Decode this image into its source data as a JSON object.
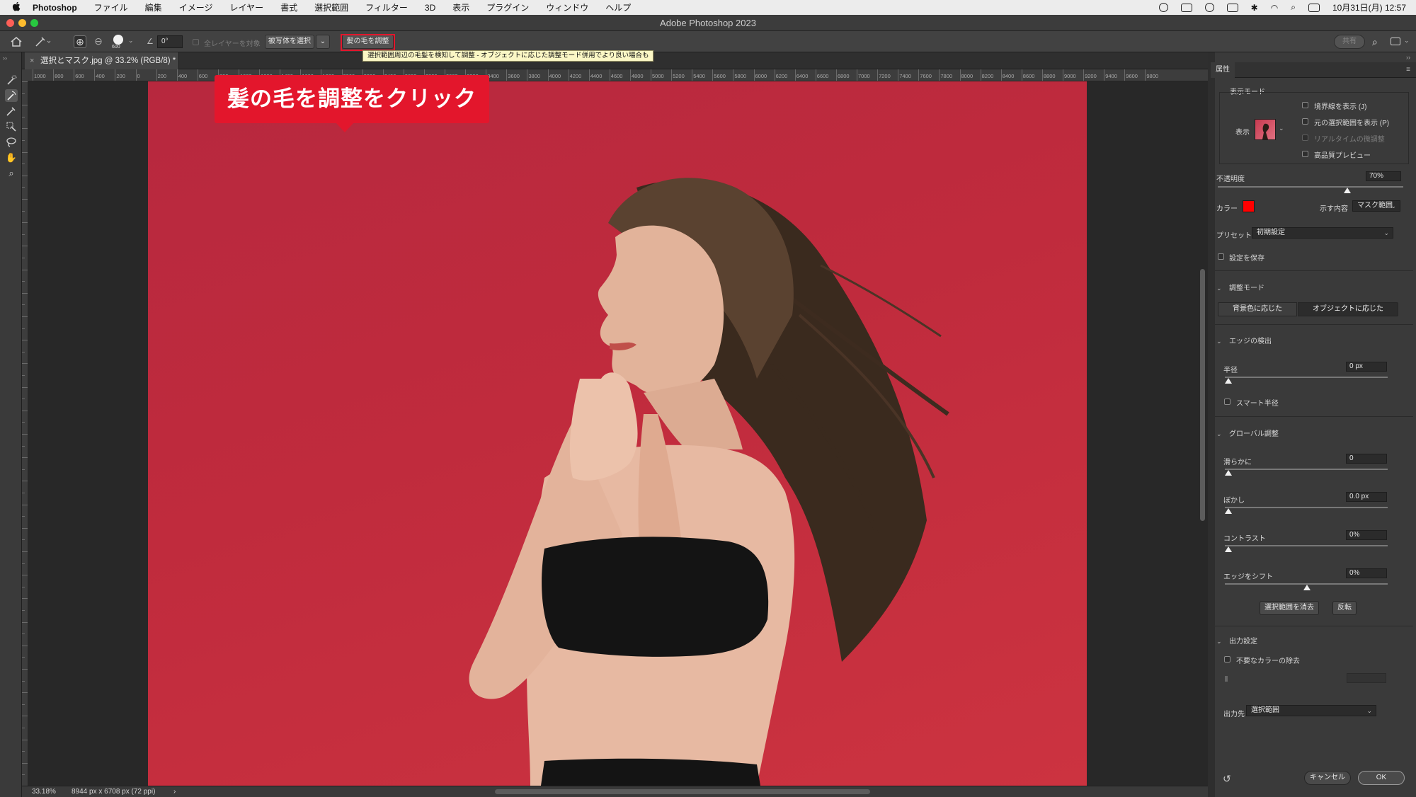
{
  "menubar": {
    "apple": "",
    "app_name": "Photoshop",
    "items": [
      "ファイル",
      "編集",
      "イメージ",
      "レイヤー",
      "書式",
      "選択範囲",
      "フィルター",
      "3D",
      "表示",
      "プラグイン",
      "ウィンドウ",
      "ヘルプ"
    ],
    "clock": "10月31日(月)  12:57"
  },
  "window": {
    "title": "Adobe Photoshop 2023"
  },
  "options_bar": {
    "brush_size": "600",
    "angle": "0°",
    "sample_all_layers": "全レイヤーを対象",
    "select_subject": "被写体を選択",
    "refine_hair": "髪の毛を調整",
    "share": "共有"
  },
  "tooltip": {
    "text": "選択範囲周辺の毛髪を検知して調整 - オブジェクトに応じた調整モード併用でより良い場合も"
  },
  "document": {
    "tab_title": "選択とマスク.jpg @ 33.2% (RGB/8) *",
    "close": "×"
  },
  "rulers": {
    "h_ticks": [
      "1000",
      "800",
      "600",
      "400",
      "200",
      "0",
      "200",
      "400",
      "600",
      "800",
      "1000",
      "1200",
      "1400",
      "1600",
      "1800",
      "2000",
      "2200",
      "2400",
      "2600",
      "2800",
      "3000",
      "3200",
      "3400",
      "3600",
      "3800",
      "4000",
      "4200",
      "4400",
      "4600",
      "4800",
      "5000",
      "5200",
      "5400",
      "5600",
      "5800",
      "6000",
      "6200",
      "6400",
      "6600",
      "6800",
      "7000",
      "7200",
      "7400",
      "7600",
      "7800",
      "8000",
      "8200",
      "8400",
      "8600",
      "8800",
      "9000",
      "9200",
      "9400",
      "9600",
      "9800"
    ]
  },
  "callout": {
    "text": "髪の毛を調整をクリック"
  },
  "statusbar": {
    "zoom": "33.18%",
    "doc_info": "8944 px x 6708 px (72 ppi)",
    "arrow": "›"
  },
  "panel": {
    "tab": "属性",
    "view_mode": {
      "title": "表示モード",
      "view_label": "表示",
      "show_edge": "境界線を表示 (J)",
      "show_original": "元の選択範囲を表示 (P)",
      "realtime": "リアルタイムの微調整",
      "hq_preview": "高品質プレビュー"
    },
    "opacity_label": "不透明度",
    "opacity_value": "70%",
    "opacity_level": 0.7,
    "color_label": "カラー",
    "color_swatch": "#ff0000",
    "indicates_label": "示す内容",
    "indicates_value": "マスク範囲",
    "preset_label": "プリセット",
    "preset_value": "初期設定",
    "save_settings": "設定を保存",
    "refine_mode": {
      "title": "調整モード",
      "color_aware": "背景色に応じた",
      "object_aware": "オブジェクトに応じた"
    },
    "edge_detection": {
      "title": "エッジの検出",
      "radius_label": "半径",
      "radius_value": "0 px",
      "smart_radius": "スマート半径"
    },
    "global_refinements": {
      "title": "グローバル調整",
      "smooth_label": "滑らかに",
      "smooth_value": "0",
      "feather_label": "ぼかし",
      "feather_value": "0.0 px",
      "contrast_label": "コントラスト",
      "contrast_value": "0%",
      "shift_edge_label": "エッジをシフト",
      "shift_edge_value": "0%",
      "clear_selection": "選択範囲を消去",
      "invert": "反転"
    },
    "output": {
      "title": "出力設定",
      "decontaminate": "不要なカラーの除去",
      "output_to_label": "出力先",
      "output_to_value": "選択範囲"
    },
    "cancel": "キャンセル",
    "ok": "OK"
  }
}
